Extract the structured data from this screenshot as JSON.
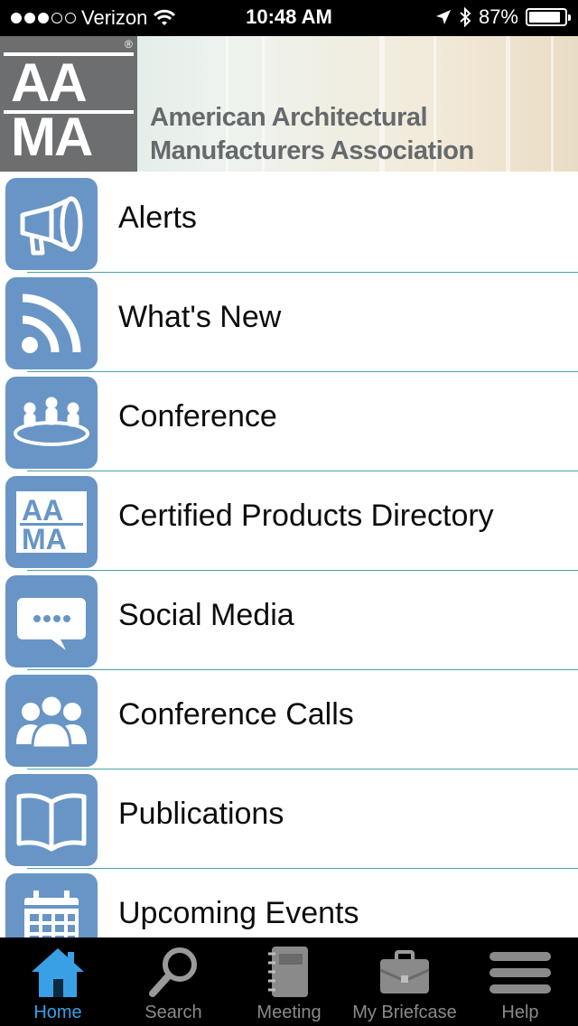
{
  "status_bar": {
    "carrier": "Verizon",
    "time": "10:48 AM",
    "battery": "87%"
  },
  "header": {
    "logo_top": "AA",
    "logo_bottom": "MA",
    "registered": "®",
    "org_line1": "American Architectural",
    "org_line2": "Manufacturers Association"
  },
  "menu": {
    "items": [
      {
        "label": "Alerts",
        "icon": "megaphone-icon"
      },
      {
        "label": "What's New",
        "icon": "rss-icon"
      },
      {
        "label": "Conference",
        "icon": "conference-table-icon"
      },
      {
        "label": "Certified Products Directory",
        "icon": "aama-logo-icon"
      },
      {
        "label": "Social Media",
        "icon": "chat-bubble-icon"
      },
      {
        "label": "Conference Calls",
        "icon": "people-group-icon"
      },
      {
        "label": "Publications",
        "icon": "open-book-icon"
      },
      {
        "label": "Upcoming Events",
        "icon": "calendar-icon"
      }
    ]
  },
  "tabbar": {
    "tabs": [
      {
        "label": "Home",
        "icon": "home-icon",
        "active": true
      },
      {
        "label": "Search",
        "icon": "magnifier-icon",
        "active": false
      },
      {
        "label": "Meeting",
        "icon": "notebook-icon",
        "active": false
      },
      {
        "label": "My Briefcase",
        "icon": "briefcase-icon",
        "active": false
      },
      {
        "label": "Help",
        "icon": "hamburger-icon",
        "active": false
      }
    ]
  },
  "colors": {
    "icon_bg": "#6895c6",
    "separator": "#4aa6a6",
    "tab_active": "#3aa0e6",
    "tab_inactive": "#8a8a8a",
    "logo_gray": "#6c6e70"
  }
}
